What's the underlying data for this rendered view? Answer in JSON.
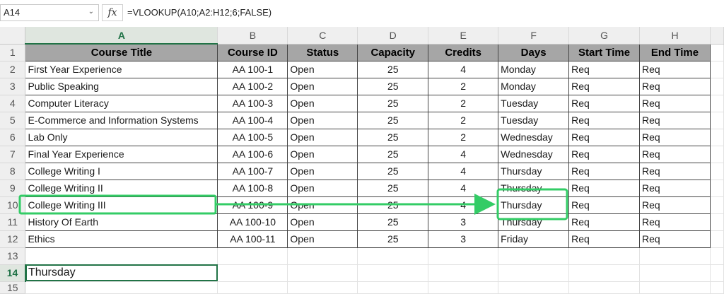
{
  "formula_bar": {
    "name_box": "A14",
    "fx_label": "fx",
    "formula": "=VLOOKUP(A10;A2:H12;6;FALSE)"
  },
  "columns": [
    "A",
    "B",
    "C",
    "D",
    "E",
    "F",
    "G",
    "H"
  ],
  "row_numbers": [
    "1",
    "2",
    "3",
    "4",
    "5",
    "6",
    "7",
    "8",
    "9",
    "10",
    "11",
    "12",
    "13",
    "14",
    "15"
  ],
  "table": {
    "headers": [
      "Course Title",
      "Course ID",
      "Status",
      "Capacity",
      "Credits",
      "Days",
      "Start Time",
      "End Time"
    ],
    "rows": [
      [
        "First Year Experience",
        "AA 100-1",
        "Open",
        "25",
        "4",
        "Monday",
        "Req",
        "Req"
      ],
      [
        "Public Speaking",
        "AA 100-2",
        "Open",
        "25",
        "2",
        "Monday",
        "Req",
        "Req"
      ],
      [
        "Computer Literacy",
        "AA 100-3",
        "Open",
        "25",
        "2",
        "Tuesday",
        "Req",
        "Req"
      ],
      [
        "E-Commerce and Information Systems",
        "AA 100-4",
        "Open",
        "25",
        "2",
        "Tuesday",
        "Req",
        "Req"
      ],
      [
        "Lab Only",
        "AA 100-5",
        "Open",
        "25",
        "2",
        "Wednesday",
        "Req",
        "Req"
      ],
      [
        "Final Year Experience",
        "AA 100-6",
        "Open",
        "25",
        "4",
        "Wednesday",
        "Req",
        "Req"
      ],
      [
        "College Writing I",
        "AA 100-7",
        "Open",
        "25",
        "4",
        "Thursday",
        "Req",
        "Req"
      ],
      [
        "College Writing II",
        "AA 100-8",
        "Open",
        "25",
        "4",
        "Thursday",
        "Req",
        "Req"
      ],
      [
        "College Writing III",
        "AA 100-9",
        "Open",
        "25",
        "4",
        "Thursday",
        "Req",
        "Req"
      ],
      [
        "History Of Earth",
        "AA 100-10",
        "Open",
        "25",
        "3",
        "Thursday",
        "Req",
        "Req"
      ],
      [
        "Ethics",
        "AA 100-11",
        "Open",
        "25",
        "3",
        "Friday",
        "Req",
        "Req"
      ]
    ]
  },
  "result_cell": {
    "value": "Thursday"
  },
  "colors": {
    "highlight": "#33cc66",
    "header_fill": "#a6a6a6",
    "selection": "#217346"
  }
}
